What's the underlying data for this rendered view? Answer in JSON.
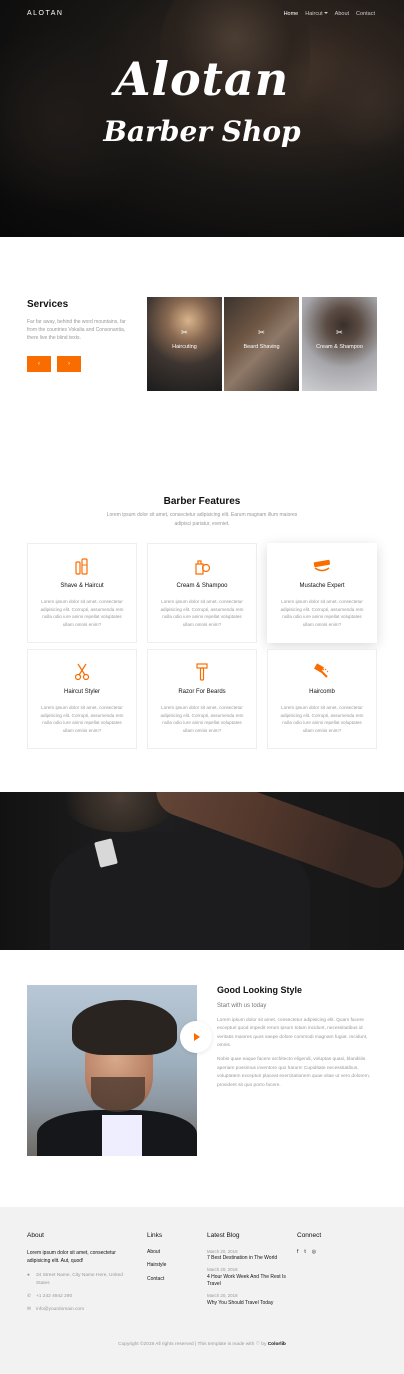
{
  "nav": {
    "brand": "ALOTAN",
    "links": [
      "Home",
      "Haircut",
      "About",
      "Contact"
    ]
  },
  "hero": {
    "title": "Alotan",
    "subtitle": "Barber Shop"
  },
  "services": {
    "title": "Services",
    "description": "Far far away, behind the word mountains, far from the countries Vokalia and Consonantia, there live the blind texts.",
    "prev_label": "‹",
    "next_label": "›",
    "cards": [
      {
        "label": "Haircuting",
        "icon": "scissors-icon"
      },
      {
        "label": "Beard Shaving",
        "icon": "scissors-icon"
      },
      {
        "label": "Cream & Shampoo",
        "icon": "scissors-icon"
      }
    ]
  },
  "features": {
    "title": "Barber Features",
    "description": "Lorem ipsum dolor sit amet, consectetur adipisicing elit. Earum magnam illum maiores adipisci pariatur, eveniet.",
    "items": [
      {
        "name": "Shave & Haircut",
        "icon": "shaving-kit-icon",
        "text": "Lorem ipsum dolor sit amet, consectetur adipisicing elit. Corrupti, assumenda rem nulla odio iure animi repellat voluptates ullam omnis enim?"
      },
      {
        "name": "Cream & Shampoo",
        "icon": "cream-bottle-icon",
        "text": "Lorem ipsum dolor sit amet, consectetur adipisicing elit. Corrupti, assumenda rem nulla odio iure animi repellat voluptates ullam omnis enim?"
      },
      {
        "name": "Mustache Expert",
        "icon": "mustache-icon",
        "text": "Lorem ipsum dolor sit amet, consectetur adipisicing elit. Corrupti, assumenda rem nulla odio iure animi repellat voluptates ullam omnis enim?"
      },
      {
        "name": "Haircut Styler",
        "icon": "scissors-icon",
        "text": "Lorem ipsum dolor sit amet, consectetur adipisicing elit. Corrupti, assumenda rem nulla odio iure animi repellat voluptates ullam omnis enim?"
      },
      {
        "name": "Razor For Beards",
        "icon": "razor-icon",
        "text": "Lorem ipsum dolor sit amet, consectetur adipisicing elit. Corrupti, assumenda rem nulla odio iure animi repellat voluptates ullam omnis enim?"
      },
      {
        "name": "Haircomb",
        "icon": "comb-icon",
        "text": "Lorem ipsum dolor sit amet, consectetur adipisicing elit. Corrupti, assumenda rem nulla odio iure animi repellat voluptates ullam omnis enim?"
      }
    ]
  },
  "style": {
    "title": "Good Looking Style",
    "subtitle": "Start with us today",
    "paragraphs": [
      "Lorem ipsum dolor sit amet, consectetur adipisicing elit. Quam facere excepturi quod impedit rerum ipsum totam incidunt, necessitatibus id veritatis maiores quos saepe dolore commodi magnam fugiat. Incidunt, omnis.",
      "Nobis quae eaque facere architecto eligendi, voluptas quasi, blanditiis aperiam possimus inventore quo harum! Cupiditate necessitatibus, voluptatem excepturi placeat exercitationem quae vitae ut vero dolorem, provident sit quo porro facere."
    ]
  },
  "footer": {
    "about": {
      "heading": "About",
      "text": "Lorem ipsum dolor sit amet, consectetur adipisicing elit. Aut, quod!",
      "address": "34 Street Name, City Name Here, United States",
      "phone": "+1 242 4942 290",
      "email": "info@yourdomain.com"
    },
    "links": {
      "heading": "Links",
      "items": [
        "About",
        "Hairstyle",
        "Contact"
      ]
    },
    "blog": {
      "heading": "Latest Blog",
      "posts": [
        {
          "date": "March 20, 2018",
          "title": "7 Best Destination in The World"
        },
        {
          "date": "March 20, 2018",
          "title": "4 Hour Work Week And The Rest Is Travel"
        },
        {
          "date": "March 20, 2018",
          "title": "Why You Should Travel Today"
        }
      ]
    },
    "connect": {
      "heading": "Connect",
      "social": [
        "f",
        "t",
        "◎"
      ]
    },
    "copyright_prefix": "Copyright ©2019 All rights reserved | This template is made with",
    "copyright_heart": "♡",
    "copyright_by": "by",
    "copyright_brand": "Colorlib"
  },
  "colors": {
    "accent": "#f96d00"
  }
}
